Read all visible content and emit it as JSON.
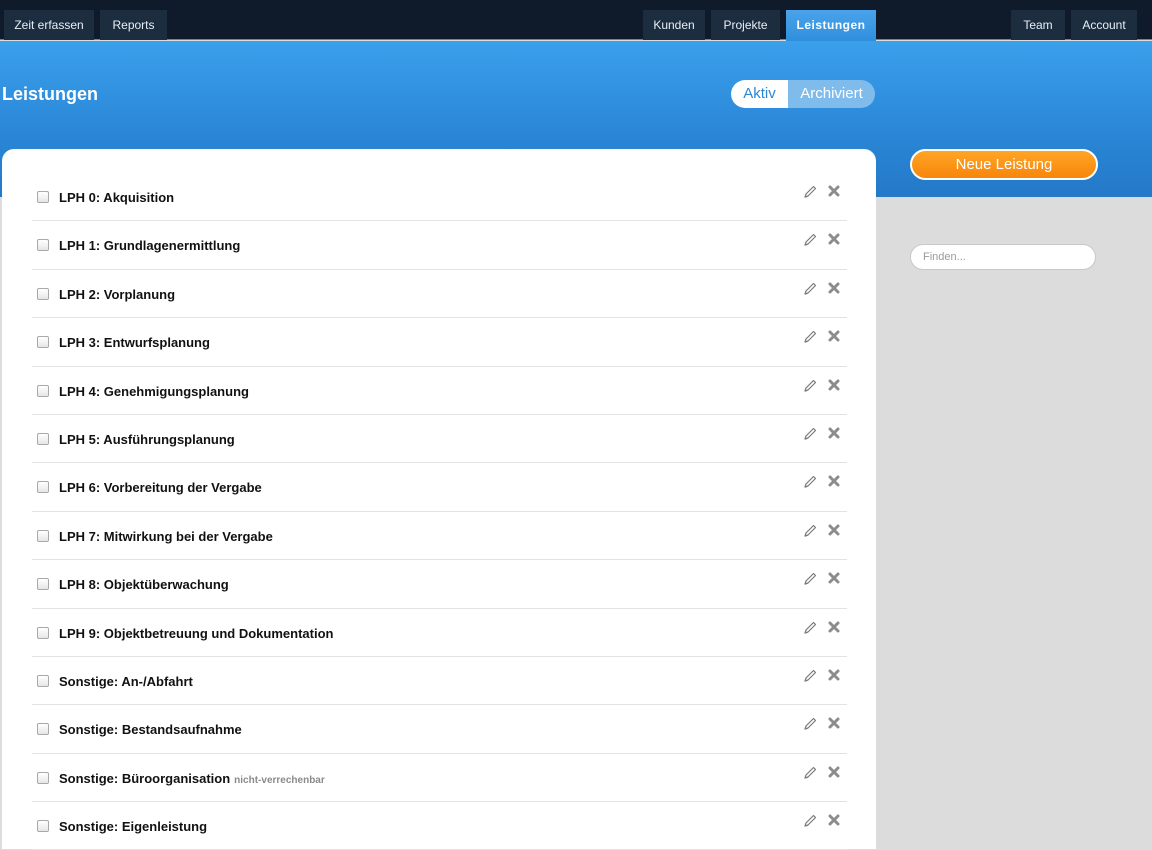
{
  "nav": {
    "zeit": "Zeit erfassen",
    "reports": "Reports",
    "kunden": "Kunden",
    "projekte": "Projekte",
    "leistungen": "Leistungen",
    "team": "Team",
    "account": "Account"
  },
  "page": {
    "title": "Leistungen",
    "toggle_active": "Aktiv",
    "toggle_archived": "Archiviert",
    "new_button": "Neue Leistung",
    "search_placeholder": "Finden..."
  },
  "items": [
    {
      "label": "LPH 0: Akquisition",
      "tag": ""
    },
    {
      "label": "LPH 1: Grundlagenermittlung",
      "tag": ""
    },
    {
      "label": "LPH 2: Vorplanung",
      "tag": ""
    },
    {
      "label": "LPH 3: Entwurfsplanung",
      "tag": ""
    },
    {
      "label": "LPH 4: Genehmigungsplanung",
      "tag": ""
    },
    {
      "label": "LPH 5: Ausführungsplanung",
      "tag": ""
    },
    {
      "label": "LPH 6: Vorbereitung der Vergabe",
      "tag": ""
    },
    {
      "label": "LPH 7: Mitwirkung bei der Vergabe",
      "tag": ""
    },
    {
      "label": "LPH 8: Objektüberwachung",
      "tag": ""
    },
    {
      "label": "LPH 9: Objektbetreuung und Dokumentation",
      "tag": ""
    },
    {
      "label": "Sonstige: An-/Abfahrt",
      "tag": ""
    },
    {
      "label": "Sonstige: Bestandsaufnahme",
      "tag": ""
    },
    {
      "label": "Sonstige: Büroorganisation",
      "tag": "nicht-verrechenbar"
    },
    {
      "label": "Sonstige: Eigenleistung",
      "tag": ""
    }
  ],
  "colors": {
    "topbar": "#0f1b2a",
    "accent_blue": "#2a86d6",
    "orange": "#f7860a"
  }
}
